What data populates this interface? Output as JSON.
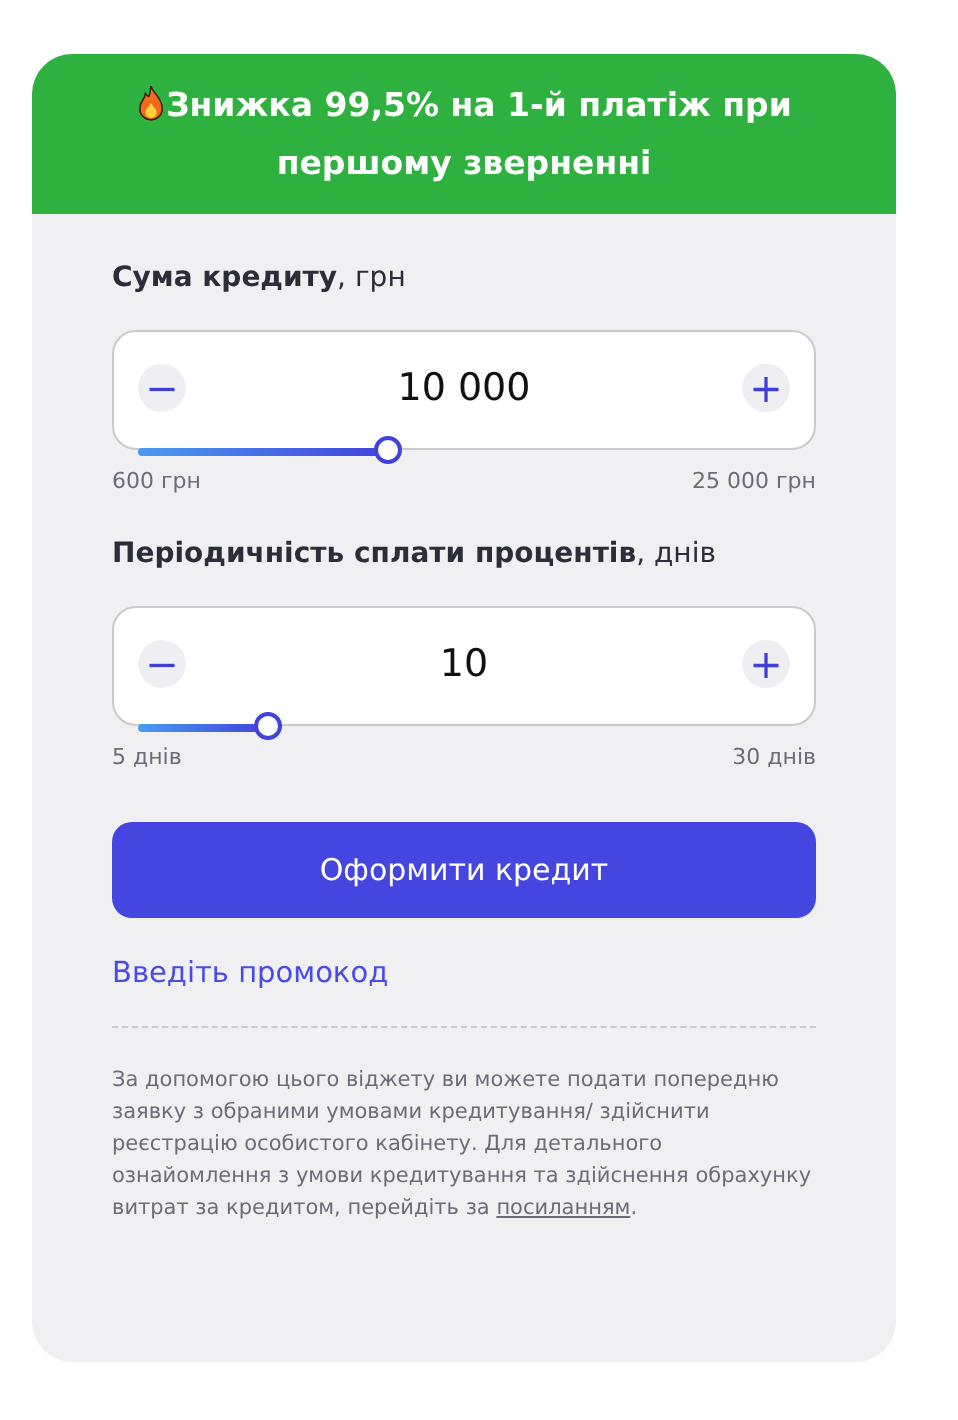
{
  "banner": {
    "text": "Знижка 99,5% на 1-й платіж при першому зверненні"
  },
  "sliders": [
    {
      "label": "Сума кредиту",
      "unit": ", грн",
      "value": "10 000",
      "minus": "−",
      "plus": "+",
      "level": 0.385,
      "min_label": "600 грн",
      "max_label": "25 000 грн"
    },
    {
      "label": "Періодичність сплати процентів",
      "unit": ", днів",
      "value": "10",
      "minus": "−",
      "plus": "+",
      "level": 0.2,
      "min_label": "5 днів",
      "max_label": "30 днів"
    }
  ],
  "submit_button": "Оформити кредит",
  "promo_link": "Введіть промокод",
  "disclaimer": {
    "text": "За допомогою цього віджету ви можете подати попередню заявку з обраними умовами кредитування/ здійснити реєстрацію особистого кабінету. Для детального ознайомлення з умови кредитування та здійснення обрахунку витрат за кредитом, перейдіть за ",
    "link": "посиланням",
    "tail": "."
  }
}
